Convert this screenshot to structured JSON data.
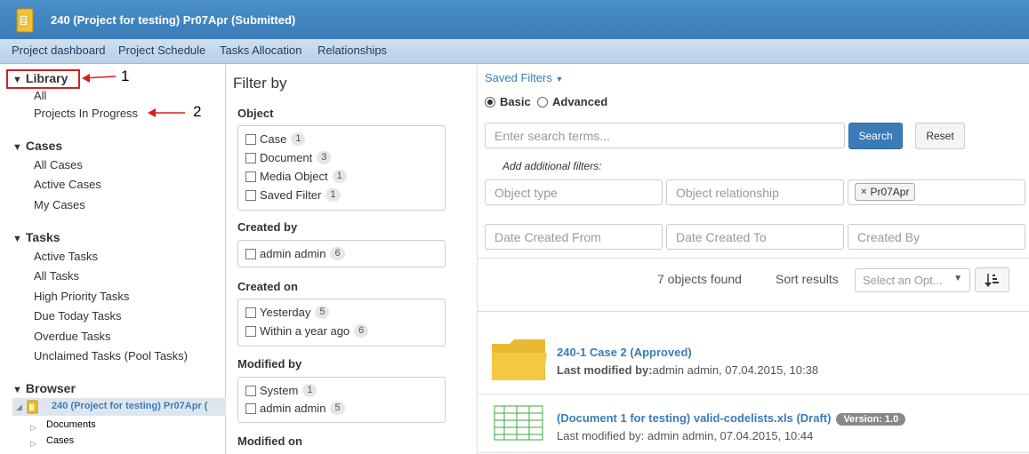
{
  "header": {
    "title": "240 (Project for testing) Pr07Apr (Submitted)"
  },
  "nav": {
    "items": [
      "Project dashboard",
      "Project Schedule",
      "Tasks Allocation",
      "Relationships"
    ]
  },
  "sidebar": {
    "library": {
      "label": "Library",
      "items": [
        "All",
        "Projects In Progress"
      ]
    },
    "cases": {
      "label": "Cases",
      "items": [
        "All Cases",
        "Active Cases",
        "My Cases"
      ]
    },
    "tasks": {
      "label": "Tasks",
      "items": [
        "Active Tasks",
        "All Tasks",
        "High Priority Tasks",
        "Due Today Tasks",
        "Overdue Tasks",
        "Unclaimed Tasks (Pool Tasks)"
      ]
    },
    "browser": {
      "label": "Browser",
      "item": "240 (Project for testing) Pr07Apr (",
      "children": [
        "Documents",
        "Cases"
      ]
    },
    "annotations": [
      "1",
      "2"
    ],
    "annotation_color": "#d62020"
  },
  "filters": {
    "title": "Filter by",
    "groups": [
      {
        "title": "Object",
        "items": [
          {
            "label": "Case",
            "count": "1"
          },
          {
            "label": "Document",
            "count": "3"
          },
          {
            "label": "Media Object",
            "count": "1"
          },
          {
            "label": "Saved Filter",
            "count": "1"
          }
        ]
      },
      {
        "title": "Created by",
        "items": [
          {
            "label": "admin admin",
            "count": "6"
          }
        ]
      },
      {
        "title": "Created on",
        "items": [
          {
            "label": "Yesterday",
            "count": "5"
          },
          {
            "label": "Within a year ago",
            "count": "6"
          }
        ]
      },
      {
        "title": "Modified by",
        "items": [
          {
            "label": "System",
            "count": "1"
          },
          {
            "label": "admin admin",
            "count": "5"
          }
        ]
      },
      {
        "title": "Modified on",
        "items": []
      }
    ]
  },
  "search": {
    "saved_filters": "Saved Filters",
    "mode_basic": "Basic",
    "mode_advanced": "Advanced",
    "selected_mode": "Basic",
    "terms_placeholder": "Enter search terms...",
    "search_button": "Search",
    "reset_button": "Reset",
    "additional_label": "Add additional filters:",
    "object_type_placeholder": "Object type",
    "object_relationship_placeholder": "Object relationship",
    "tag": "Pr07Apr",
    "date_from_placeholder": "Date Created From",
    "date_to_placeholder": "Date Created To",
    "created_by_placeholder": "Created By"
  },
  "results": {
    "count_text": "7 objects found",
    "sort_label": "Sort results",
    "sort_placeholder": "Select an Opt...",
    "items": [
      {
        "title": "240-1 Case 2 (Approved)",
        "meta_label": "Last modified by:",
        "meta_value": "admin admin, 07.04.2015, 10:38"
      },
      {
        "title": "(Document 1 for testing) valid-codelists.xls (Draft)",
        "version": "Version: 1.0",
        "meta": "Last modified by: admin admin, 07.04.2015, 10:44"
      }
    ]
  },
  "colors": {
    "brand": "#3a7cb8",
    "folder": "#f5c842",
    "spreadsheet": "#3aa83a"
  }
}
